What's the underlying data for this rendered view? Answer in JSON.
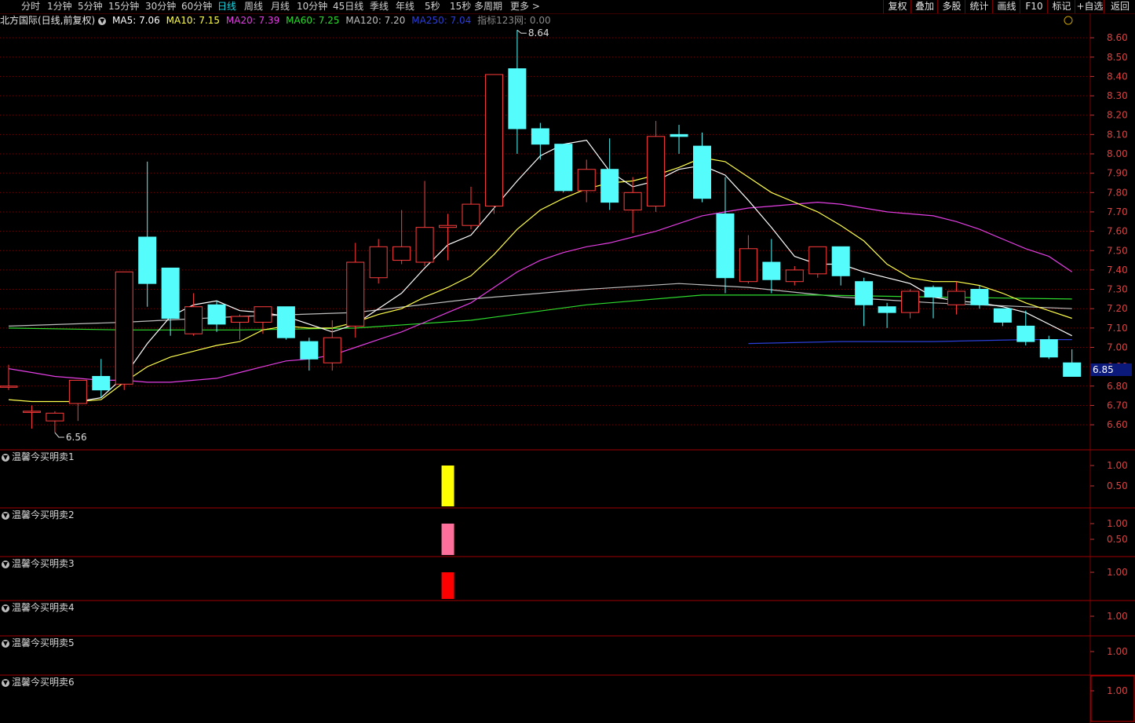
{
  "toolbar": {
    "periods": [
      "分时",
      "1分钟",
      "5分钟",
      "15分钟",
      "30分钟",
      "60分钟",
      "日线",
      "周线",
      "月线",
      "10分钟",
      "45日线",
      "季线",
      "年线",
      "5秒",
      "15秒",
      "多周期",
      "更多 >"
    ],
    "active_period": "日线",
    "right_buttons": [
      "复权",
      "叠加",
      "多股",
      "统计",
      "画线",
      "F10",
      "标记",
      "+自选",
      "返回"
    ]
  },
  "header": {
    "stock_title": "北方国际(日线,前复权)",
    "ma5": "MA5: 7.06",
    "ma10": "MA10: 7.15",
    "ma20": "MA20: 7.39",
    "ma60": "MA60: 7.25",
    "ma120": "MA120: 7.20",
    "ma250": "MA250: 7.04",
    "indicator": "指标123网: 0.00"
  },
  "colors": {
    "up": "#ff3c3c",
    "down": "#54fcfc",
    "grid": "#7a0000",
    "ma5": "#ffffff",
    "ma10": "#ffff4c",
    "ma20": "#e33ee3",
    "ma60": "#2ddc2d",
    "ma120": "#bebebe",
    "ma250": "#2b3fd8"
  },
  "chart_data": {
    "type": "candlestick",
    "y_axis": {
      "min": 6.56,
      "max": 8.64,
      "ticks": [
        "8.60",
        "8.50",
        "8.40",
        "8.30",
        "8.20",
        "8.10",
        "8.00",
        "7.90",
        "7.80",
        "7.70",
        "7.60",
        "7.50",
        "7.40",
        "7.30",
        "7.20",
        "7.10",
        "7.00",
        "6.90",
        "6.80",
        "6.70",
        "6.60"
      ]
    },
    "current_price": "6.85",
    "high_label": "8.64",
    "low_label": "6.56",
    "candles": [
      {
        "o": 6.8,
        "h": 6.91,
        "l": 6.78,
        "c": 6.8
      },
      {
        "o": 6.67,
        "h": 6.7,
        "l": 6.58,
        "c": 6.67
      },
      {
        "o": 6.62,
        "h": 6.67,
        "l": 6.56,
        "c": 6.66
      },
      {
        "o": 6.71,
        "h": 6.83,
        "l": 6.62,
        "c": 6.83
      },
      {
        "o": 6.85,
        "h": 6.94,
        "l": 6.74,
        "c": 6.78
      },
      {
        "o": 6.81,
        "h": 7.39,
        "l": 6.78,
        "c": 7.39
      },
      {
        "o": 7.57,
        "h": 7.96,
        "l": 7.21,
        "c": 7.33
      },
      {
        "o": 7.41,
        "h": 7.41,
        "l": 7.06,
        "c": 7.15
      },
      {
        "o": 7.07,
        "h": 7.28,
        "l": 7.06,
        "c": 7.21
      },
      {
        "o": 7.22,
        "h": 7.24,
        "l": 7.08,
        "c": 7.12
      },
      {
        "o": 7.13,
        "h": 7.17,
        "l": 7.04,
        "c": 7.16
      },
      {
        "o": 7.13,
        "h": 7.21,
        "l": 7.07,
        "c": 7.21
      },
      {
        "o": 7.21,
        "h": 7.21,
        "l": 7.04,
        "c": 7.05
      },
      {
        "o": 7.03,
        "h": 7.05,
        "l": 6.88,
        "c": 6.94
      },
      {
        "o": 6.92,
        "h": 7.14,
        "l": 6.88,
        "c": 7.05
      },
      {
        "o": 7.11,
        "h": 7.54,
        "l": 7.05,
        "c": 7.44
      },
      {
        "o": 7.36,
        "h": 7.56,
        "l": 7.33,
        "c": 7.52
      },
      {
        "o": 7.45,
        "h": 7.71,
        "l": 7.43,
        "c": 7.52
      },
      {
        "o": 7.44,
        "h": 7.86,
        "l": 7.42,
        "c": 7.62
      },
      {
        "o": 7.62,
        "h": 7.69,
        "l": 7.45,
        "c": 7.63
      },
      {
        "o": 7.63,
        "h": 7.83,
        "l": 7.61,
        "c": 7.74
      },
      {
        "o": 7.73,
        "h": 8.41,
        "l": 7.69,
        "c": 8.41
      },
      {
        "o": 8.44,
        "h": 8.64,
        "l": 8.0,
        "c": 8.13
      },
      {
        "o": 8.13,
        "h": 8.16,
        "l": 7.97,
        "c": 8.05
      },
      {
        "o": 8.05,
        "h": 8.05,
        "l": 7.8,
        "c": 7.81
      },
      {
        "o": 7.81,
        "h": 7.97,
        "l": 7.75,
        "c": 7.92
      },
      {
        "o": 7.92,
        "h": 8.08,
        "l": 7.71,
        "c": 7.75
      },
      {
        "o": 7.71,
        "h": 7.88,
        "l": 7.59,
        "c": 7.8
      },
      {
        "o": 7.73,
        "h": 8.17,
        "l": 7.7,
        "c": 8.09
      },
      {
        "o": 8.1,
        "h": 8.15,
        "l": 8.0,
        "c": 8.09
      },
      {
        "o": 8.04,
        "h": 8.11,
        "l": 7.75,
        "c": 7.77
      },
      {
        "o": 7.69,
        "h": 7.88,
        "l": 7.28,
        "c": 7.36
      },
      {
        "o": 7.34,
        "h": 7.58,
        "l": 7.33,
        "c": 7.51
      },
      {
        "o": 7.44,
        "h": 7.56,
        "l": 7.28,
        "c": 7.35
      },
      {
        "o": 7.34,
        "h": 7.42,
        "l": 7.32,
        "c": 7.4
      },
      {
        "o": 7.38,
        "h": 7.52,
        "l": 7.36,
        "c": 7.52
      },
      {
        "o": 7.52,
        "h": 7.52,
        "l": 7.32,
        "c": 7.37
      },
      {
        "o": 7.34,
        "h": 7.36,
        "l": 7.11,
        "c": 7.22
      },
      {
        "o": 7.21,
        "h": 7.23,
        "l": 7.1,
        "c": 7.18
      },
      {
        "o": 7.18,
        "h": 7.3,
        "l": 7.15,
        "c": 7.29
      },
      {
        "o": 7.31,
        "h": 7.32,
        "l": 7.15,
        "c": 7.26
      },
      {
        "o": 7.22,
        "h": 7.34,
        "l": 7.17,
        "c": 7.29
      },
      {
        "o": 7.3,
        "h": 7.32,
        "l": 7.2,
        "c": 7.22
      },
      {
        "o": 7.2,
        "h": 7.2,
        "l": 7.11,
        "c": 7.13
      },
      {
        "o": 7.11,
        "h": 7.19,
        "l": 7.01,
        "c": 7.03
      },
      {
        "o": 7.04,
        "h": 7.06,
        "l": 6.94,
        "c": 6.95
      },
      {
        "o": 6.92,
        "h": 6.99,
        "l": 6.86,
        "c": 6.85
      }
    ],
    "ma_lines": {
      "ma5": [
        [
          3,
          6.72
        ],
        [
          4,
          6.74
        ],
        [
          5,
          6.85
        ],
        [
          6,
          7.02
        ],
        [
          7,
          7.16
        ],
        [
          8,
          7.22
        ],
        [
          9,
          7.24
        ],
        [
          10,
          7.19
        ],
        [
          11,
          7.18
        ],
        [
          12,
          7.16
        ],
        [
          13,
          7.12
        ],
        [
          14,
          7.08
        ],
        [
          15,
          7.12
        ],
        [
          16,
          7.2
        ],
        [
          17,
          7.28
        ],
        [
          18,
          7.41
        ],
        [
          19,
          7.53
        ],
        [
          20,
          7.58
        ],
        [
          21,
          7.72
        ],
        [
          22,
          7.86
        ],
        [
          23,
          7.99
        ],
        [
          24,
          8.05
        ],
        [
          25,
          8.07
        ],
        [
          26,
          7.91
        ],
        [
          27,
          7.83
        ],
        [
          28,
          7.86
        ],
        [
          29,
          7.92
        ],
        [
          30,
          7.94
        ],
        [
          31,
          7.89
        ],
        [
          32,
          7.76
        ],
        [
          33,
          7.62
        ],
        [
          34,
          7.47
        ],
        [
          35,
          7.43
        ],
        [
          36,
          7.43
        ],
        [
          37,
          7.39
        ],
        [
          38,
          7.36
        ],
        [
          39,
          7.33
        ],
        [
          40,
          7.26
        ],
        [
          41,
          7.24
        ],
        [
          42,
          7.23
        ],
        [
          43,
          7.21
        ],
        [
          44,
          7.18
        ],
        [
          45,
          7.12
        ],
        [
          46,
          7.06
        ]
      ],
      "ma10": [
        [
          0,
          6.73
        ],
        [
          1,
          6.72
        ],
        [
          2,
          6.72
        ],
        [
          3,
          6.72
        ],
        [
          4,
          6.73
        ],
        [
          5,
          6.82
        ],
        [
          6,
          6.9
        ],
        [
          7,
          6.95
        ],
        [
          8,
          6.98
        ],
        [
          9,
          7.01
        ],
        [
          10,
          7.03
        ],
        [
          11,
          7.09
        ],
        [
          12,
          7.11
        ],
        [
          13,
          7.1
        ],
        [
          14,
          7.1
        ],
        [
          15,
          7.13
        ],
        [
          16,
          7.17
        ],
        [
          17,
          7.2
        ],
        [
          18,
          7.26
        ],
        [
          19,
          7.31
        ],
        [
          20,
          7.37
        ],
        [
          21,
          7.48
        ],
        [
          22,
          7.61
        ],
        [
          23,
          7.71
        ],
        [
          24,
          7.77
        ],
        [
          25,
          7.82
        ],
        [
          26,
          7.85
        ],
        [
          27,
          7.86
        ],
        [
          28,
          7.89
        ],
        [
          29,
          7.93
        ],
        [
          30,
          7.98
        ],
        [
          31,
          7.96
        ],
        [
          32,
          7.88
        ],
        [
          33,
          7.8
        ],
        [
          34,
          7.75
        ],
        [
          35,
          7.7
        ],
        [
          36,
          7.63
        ],
        [
          37,
          7.55
        ],
        [
          38,
          7.43
        ],
        [
          39,
          7.36
        ],
        [
          40,
          7.34
        ],
        [
          41,
          7.34
        ],
        [
          42,
          7.32
        ],
        [
          43,
          7.28
        ],
        [
          44,
          7.23
        ],
        [
          45,
          7.19
        ],
        [
          46,
          7.15
        ]
      ],
      "ma20": [
        [
          0,
          6.89
        ],
        [
          1,
          6.87
        ],
        [
          2,
          6.85
        ],
        [
          3,
          6.84
        ],
        [
          4,
          6.83
        ],
        [
          5,
          6.83
        ],
        [
          6,
          6.82
        ],
        [
          7,
          6.82
        ],
        [
          8,
          6.83
        ],
        [
          9,
          6.84
        ],
        [
          10,
          6.87
        ],
        [
          11,
          6.9
        ],
        [
          12,
          6.93
        ],
        [
          13,
          6.94
        ],
        [
          14,
          6.96
        ],
        [
          15,
          7.0
        ],
        [
          16,
          7.04
        ],
        [
          17,
          7.08
        ],
        [
          18,
          7.13
        ],
        [
          19,
          7.18
        ],
        [
          20,
          7.23
        ],
        [
          21,
          7.31
        ],
        [
          22,
          7.39
        ],
        [
          23,
          7.45
        ],
        [
          24,
          7.49
        ],
        [
          25,
          7.52
        ],
        [
          26,
          7.54
        ],
        [
          27,
          7.57
        ],
        [
          28,
          7.6
        ],
        [
          29,
          7.64
        ],
        [
          30,
          7.68
        ],
        [
          31,
          7.7
        ],
        [
          32,
          7.72
        ],
        [
          33,
          7.73
        ],
        [
          34,
          7.74
        ],
        [
          35,
          7.75
        ],
        [
          36,
          7.74
        ],
        [
          37,
          7.72
        ],
        [
          38,
          7.7
        ],
        [
          39,
          7.69
        ],
        [
          40,
          7.68
        ],
        [
          41,
          7.65
        ],
        [
          42,
          7.61
        ],
        [
          43,
          7.56
        ],
        [
          44,
          7.51
        ],
        [
          45,
          7.47
        ],
        [
          46,
          7.39
        ]
      ],
      "ma60": [
        [
          0,
          7.1
        ],
        [
          5,
          7.09
        ],
        [
          10,
          7.09
        ],
        [
          15,
          7.1
        ],
        [
          20,
          7.14
        ],
        [
          25,
          7.22
        ],
        [
          30,
          7.27
        ],
        [
          35,
          7.27
        ],
        [
          40,
          7.26
        ],
        [
          46,
          7.25
        ]
      ],
      "ma120": [
        [
          0,
          7.11
        ],
        [
          5,
          7.13
        ],
        [
          10,
          7.16
        ],
        [
          15,
          7.18
        ],
        [
          20,
          7.25
        ],
        [
          25,
          7.3
        ],
        [
          29,
          7.33
        ],
        [
          32,
          7.31
        ],
        [
          36,
          7.26
        ],
        [
          40,
          7.23
        ],
        [
          46,
          7.2
        ]
      ],
      "ma250": [
        [
          32,
          7.02
        ],
        [
          36,
          7.03
        ],
        [
          40,
          7.03
        ],
        [
          44,
          7.04
        ],
        [
          46,
          7.04
        ]
      ]
    },
    "indicator_panels": [
      {
        "label": "温馨今买明卖1",
        "ticks": [
          "1.00",
          "0.50"
        ],
        "bar_color": "#ffff00",
        "bar_index": 19,
        "value": 1.0
      },
      {
        "label": "温馨今买明卖2",
        "ticks": [
          "1.00",
          "0.50"
        ],
        "bar_color": "#ff6f9c",
        "bar_index": 19,
        "value": 1.0
      },
      {
        "label": "温馨今买明卖3",
        "ticks": [
          "1.00"
        ],
        "bar_color": "#ff0000",
        "bar_index": 19,
        "value": 1.0
      },
      {
        "label": "温馨今买明卖4",
        "ticks": [
          "1.00"
        ],
        "bar_color": null,
        "bar_index": null,
        "value": 0
      },
      {
        "label": "温馨今买明卖5",
        "ticks": [
          "1.00"
        ],
        "bar_color": null,
        "bar_index": null,
        "value": 0
      },
      {
        "label": "温馨今买明卖6",
        "ticks": [
          "1.00"
        ],
        "bar_color": null,
        "bar_index": null,
        "value": 0
      }
    ]
  }
}
